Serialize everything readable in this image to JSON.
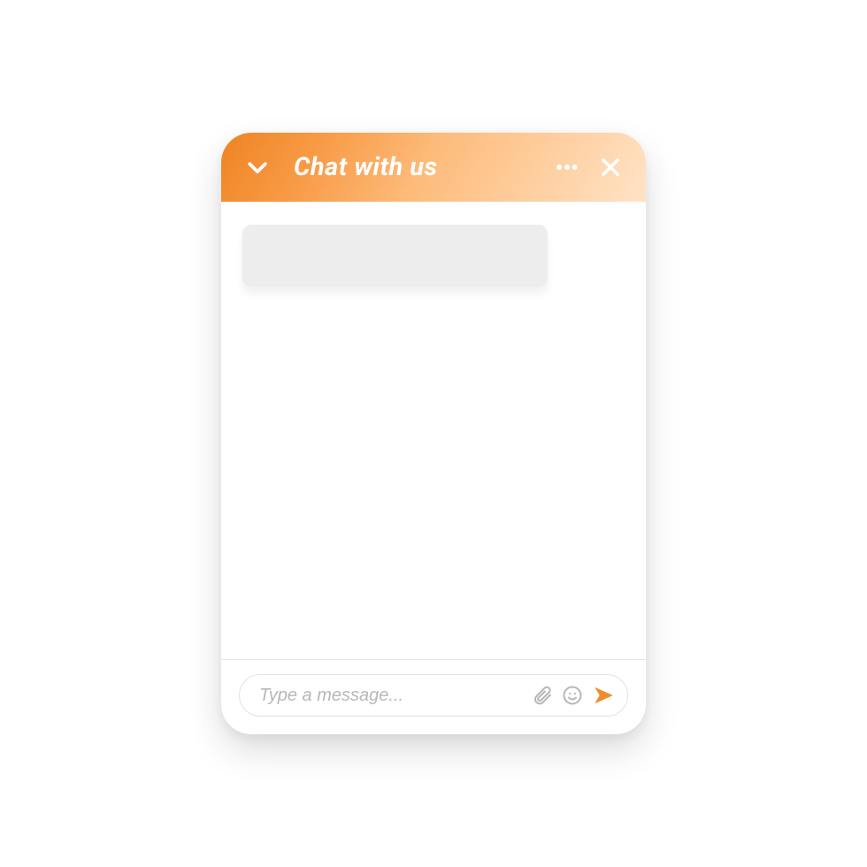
{
  "header": {
    "title": "Chat with us"
  },
  "composer": {
    "placeholder": "Type a message..."
  },
  "colors": {
    "accent": "#f28a2e",
    "icon_muted": "#b7b7b7"
  }
}
